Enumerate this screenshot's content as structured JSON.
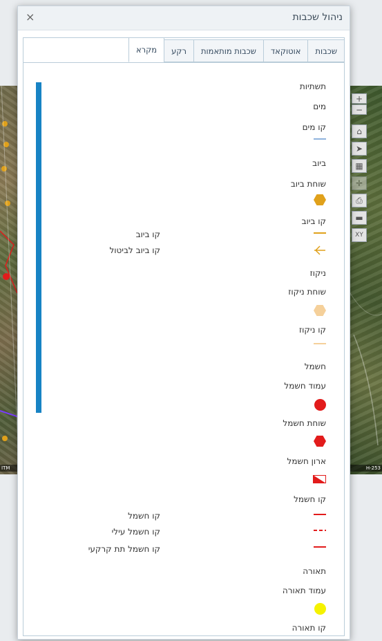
{
  "dialog": {
    "title": "ניהול שכבות",
    "close": "×"
  },
  "tabs": [
    {
      "label": "שכבות",
      "active": false
    },
    {
      "label": "אוטוקאד",
      "active": false
    },
    {
      "label": "שכבות מותאמות",
      "active": false
    },
    {
      "label": "רקע",
      "active": false
    },
    {
      "label": "מקרא",
      "active": true
    }
  ],
  "map": {
    "footer_left": "ITM",
    "footer_right": "H-253"
  },
  "legend": {
    "infrastructure": "תשתיות",
    "water": "מים",
    "water_line": "קו מים",
    "sewage": "ביוב",
    "sewage_shaft": "שוחת ביוב",
    "sewage_line": "קו ביוב",
    "sewage_line_item": "קו ביוב",
    "sewage_line_cancel": "קו ביוב לביטול",
    "drainage": "ניקוז",
    "drainage_shaft": "שוחת ניקוז",
    "drainage_line": "קו ניקוז",
    "electricity": "חשמל",
    "electric_pole": "עמוד חשמל",
    "electric_shaft": "שוחת חשמל",
    "electric_cabinet": "ארון חשמל",
    "electric_line": "קו חשמל",
    "electric_line_item": "קו חשמל",
    "electric_overhead": "קו חשמל עילי",
    "electric_underground": "קו חשמל תת קרקעי",
    "lighting": "תאורה",
    "light_pole": "עמוד תאורה",
    "light_line": "קו תאורה"
  },
  "colors": {
    "accent": "#1883c4",
    "water": "#8fb3dd",
    "sewage": "#e0a11b",
    "drainage": "#f5d09a",
    "electric": "#e21b1b",
    "lighting": "#f5f200"
  },
  "icons": {
    "zoom_in": "plus-icon",
    "zoom_out": "minus-icon",
    "home": "home-icon",
    "locate": "navigation-icon",
    "layers": "layers-icon",
    "print": "print-icon",
    "measure": "ruler-icon",
    "xy": "xy-coordinates-icon"
  }
}
